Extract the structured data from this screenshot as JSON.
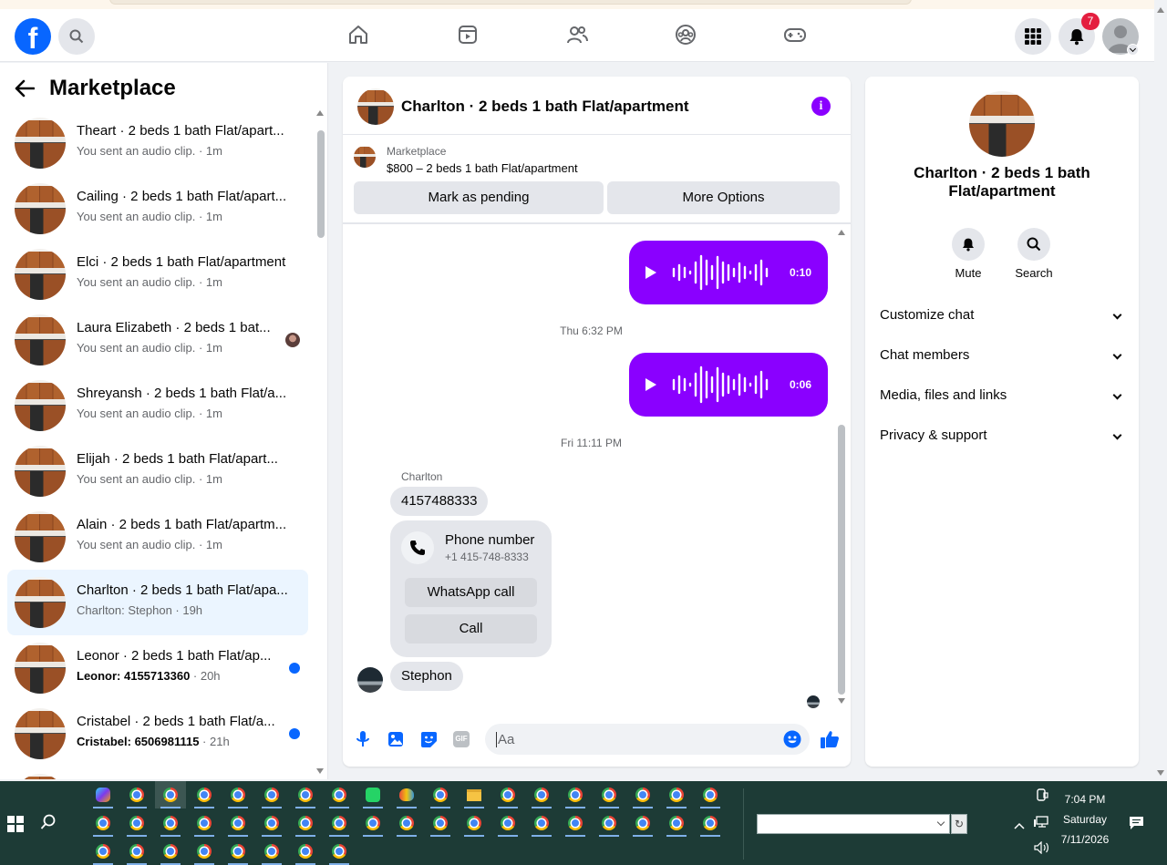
{
  "topbar": {
    "logo_letter": "f",
    "notification_count": "7",
    "icons": [
      "facebook-logo",
      "search-icon",
      "home-icon",
      "video-icon",
      "friends-icon",
      "groups-icon",
      "gaming-icon",
      "menu-grid-icon",
      "bell-icon",
      "profile-avatar"
    ]
  },
  "sidebar": {
    "title": "Marketplace",
    "conversations": [
      {
        "name": "Theart · 2 beds 1 bath Flat/apart...",
        "preview": "You sent an audio clip. · 1m",
        "unread": false
      },
      {
        "name": "Cailing · 2 beds 1 bath Flat/apart...",
        "preview": "You sent an audio clip. · 1m",
        "unread": false
      },
      {
        "name": "Elci · 2 beds 1 bath Flat/apartment",
        "preview": "You sent an audio clip. · 1m",
        "unread": false
      },
      {
        "name": "Laura Elizabeth · 2 beds 1 bat...",
        "preview": "You sent an audio clip. · 1m",
        "unread": false
      },
      {
        "name": "Shreyansh · 2 beds 1 bath Flat/a...",
        "preview": "You sent an audio clip. · 1m",
        "unread": false
      },
      {
        "name": "Elijah · 2 beds 1 bath Flat/apart...",
        "preview": "You sent an audio clip. · 1m",
        "unread": false
      },
      {
        "name": "Alain · 2 beds 1 bath Flat/apartm...",
        "preview": "You sent an audio clip. · 1m",
        "unread": false
      },
      {
        "name": "Charlton · 2 beds 1 bath Flat/apa...",
        "preview": "Charlton: Stephon · 19h",
        "unread": false,
        "active": true
      },
      {
        "name": "Leonor · 2 beds 1 bath Flat/ap...",
        "preview_main": "Leonor: 4155713360",
        "preview_time": " · 20h",
        "unread": true
      },
      {
        "name": "Cristabel · 2 beds 1 bath Flat/a...",
        "preview_main": "Cristabel: 6506981115",
        "preview_time": " · 21h",
        "unread": true
      }
    ]
  },
  "chat": {
    "title": "Charlton · 2 beds 1 bath Flat/apartment",
    "marketplace_label": "Marketplace",
    "listing": "$800 – 2 beds 1 bath Flat/apartment",
    "mark_pending": "Mark as pending",
    "more_options": "More Options",
    "messages": {
      "audio1_duration": "0:10",
      "stamp1": "Thu 6:32 PM",
      "audio2_duration": "0:06",
      "stamp2": "Fri 11:11 PM",
      "sender": "Charlton",
      "number_text": "4157488333",
      "phone_card_title": "Phone number",
      "phone_card_number": "+1 415-748-8333",
      "whatsapp_call": "WhatsApp call",
      "call": "Call",
      "last_message": "Stephon"
    },
    "composer_placeholder": "Aa",
    "gif_label": "GIF",
    "accent_color": "#8a00ff"
  },
  "info_panel": {
    "title": "Charlton · 2 beds 1 bath Flat/apartment",
    "mute": "Mute",
    "search": "Search",
    "sections": [
      "Customize chat",
      "Chat members",
      "Media, files and links",
      "Privacy & support"
    ]
  },
  "taskbar": {
    "time": "7:04 PM",
    "day": "Saturday",
    "date": "7/11/2026"
  }
}
